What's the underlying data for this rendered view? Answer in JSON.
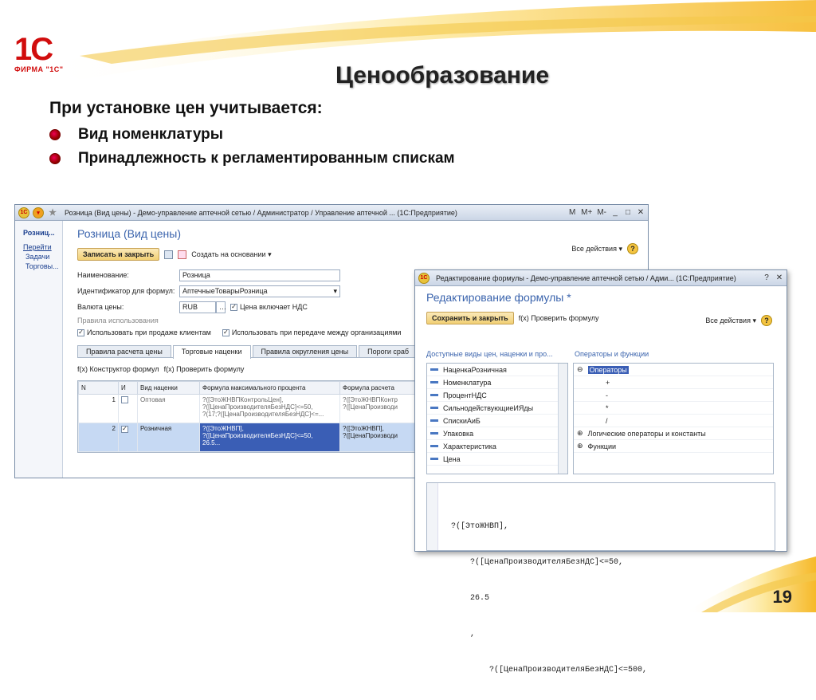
{
  "slide": {
    "logo_text": "1С",
    "logo_firm": "ФИРМА \"1С\"",
    "title": "Ценообразование",
    "subtitle": "При  установке цен учитывается:",
    "bullets": [
      "Вид номенклатуры",
      "Принадлежность к регламентированным спискам"
    ],
    "page_number": "19"
  },
  "window1": {
    "title": "Розница (Вид цены) - Демо-управление аптечной сетью / Администратор / Управление аптечной ... (1С:Предприятие)",
    "title_buttons": [
      "M",
      "M+",
      "M-",
      "_",
      "□",
      "✕"
    ],
    "sidebar": {
      "selected": "Розниц...",
      "group": "Перейти",
      "items": [
        "Задачи",
        "Торговы..."
      ]
    },
    "form_title": "Розница (Вид цены)",
    "toolbar": {
      "save_close": "Записать и закрыть",
      "create_based": "Создать на основании",
      "all_actions": "Все действия"
    },
    "fields": {
      "name_label": "Наименование:",
      "name_value": "Розница",
      "formula_id_label": "Идентификатор для формул:",
      "formula_id_value": "АптечныеТоварыРозница",
      "currency_label": "Валюта цены:",
      "currency_value": "RUB",
      "vat_label": "Цена включает НДС"
    },
    "usage": {
      "section": "Правила использования",
      "use_sale": "Использовать при продаже клиентам",
      "use_transfer": "Использовать при передаче между организациями"
    },
    "tabs": [
      "Правила расчета цены",
      "Торговые наценки",
      "Правила округления цены",
      "Пороги сраб"
    ],
    "grid_toolbar": {
      "constructor": "Конструктор формул",
      "check": "Проверить формулу"
    },
    "grid": {
      "columns": [
        "N",
        "И",
        "Вид наценки",
        "Формула максимального процента",
        "Формула расчета"
      ],
      "rows": [
        {
          "n": "1",
          "checked": false,
          "kind": "Оптовая",
          "formula": "?([ЭтоЖНВПКонтрольЦен],\n?([ЦенаПроизводителяБезНДС]<=50,\n?(17;?([ЦенаПроизводителяБезНДС]<=...",
          "calc": "?([ЭтоЖНВПКонтр\n?([ЦенаПроизводи"
        },
        {
          "n": "2",
          "checked": true,
          "kind": "Розничная",
          "formula": "?([ЭтоЖНВП],\n?([ЦенаПроизводителяБезНДС]<=50,\n26.5...",
          "calc": "?([ЭтоЖНВП],\n?([ЦенаПроизводи"
        }
      ]
    }
  },
  "window2": {
    "title": "Редактирование формулы - Демо-управление аптечной сетью / Адми... (1С:Предприятие)",
    "title_buttons": [
      "?",
      "✕"
    ],
    "form_title": "Редактирование формулы *",
    "toolbar": {
      "save_close": "Сохранить и закрыть",
      "check": "Проверить формулу",
      "all_actions": "Все действия"
    },
    "left_label": "Доступные виды цен, наценки и про...",
    "right_label": "Операторы и функции",
    "left_items": [
      "НаценкаРозничная",
      "Номенклатура",
      "ПроцентНДС",
      "СильнодействующиеИЯды",
      "СпискиАиБ",
      "Упаковка",
      "Характеристика",
      "Цена"
    ],
    "operators_group": "Операторы",
    "operators": [
      "+",
      "-",
      "*",
      "/"
    ],
    "other_groups": [
      "Логические операторы и константы",
      "Функции"
    ],
    "code_lines": [
      "?([ЭтоЖНВП],",
      "    ?([ЦенаПроизводителяБезНДС]<=50,",
      "    26.5",
      "    ,",
      "        ?([ЦенаПроизводителяБезНДС]<=500,"
    ]
  }
}
